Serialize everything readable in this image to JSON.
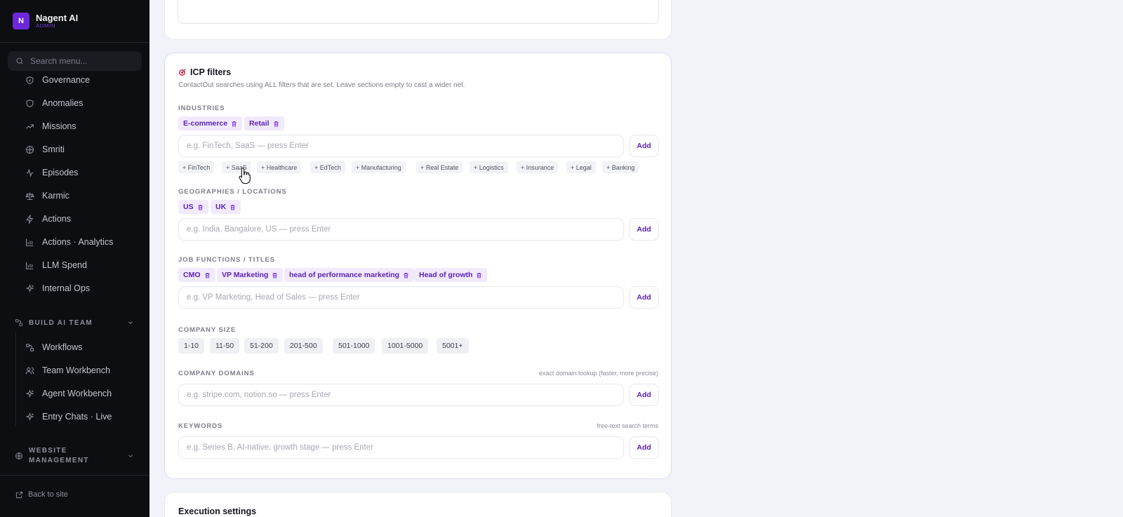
{
  "app": {
    "logo_letter": "N",
    "name": "Nagent AI",
    "role": "ADMIN"
  },
  "sidebar": {
    "search_placeholder": "Search menu...",
    "items": [
      {
        "label": "Governance",
        "icon": "shield-icon"
      },
      {
        "label": "Anomalies",
        "icon": "shield-icon"
      },
      {
        "label": "Missions",
        "icon": "trending-up-icon"
      },
      {
        "label": "Smriti",
        "icon": "brain-icon"
      },
      {
        "label": "Episodes",
        "icon": "activity-icon"
      },
      {
        "label": "Karmic",
        "icon": "scale-icon"
      },
      {
        "label": "Actions",
        "icon": "lightning-icon"
      },
      {
        "label": "Actions · Analytics",
        "icon": "bar-chart-icon"
      },
      {
        "label": "LLM Spend",
        "icon": "bar-chart-icon"
      },
      {
        "label": "Internal Ops",
        "icon": "sparkles-icon"
      }
    ],
    "section_build": {
      "label": "BUILD AI TEAM",
      "items": [
        {
          "label": "Workflows",
          "icon": "workflow-icon"
        },
        {
          "label": "Team Workbench",
          "icon": "users-icon"
        },
        {
          "label": "Agent Workbench",
          "icon": "sparkles-icon"
        },
        {
          "label": "Entry Chats · Live",
          "icon": "sparkles-icon"
        }
      ]
    },
    "section_website": {
      "label_line1": "WEBSITE",
      "label_line2": "MANAGEMENT"
    },
    "back_link": "Back to site"
  },
  "icp": {
    "title": "ICP filters",
    "subtitle": "ContactOut searches using ALL filters that are set. Leave sections empty to cast a wider net.",
    "industries": {
      "label": "INDUSTRIES",
      "chips": [
        "E-commerce",
        "Retail"
      ],
      "placeholder": "e.g. FinTech, SaaS — press Enter",
      "suggestions": [
        "+ FinTech",
        "+ SaaS",
        "+ Healthcare",
        "+ EdTech",
        "+ Manufacturing",
        "+ Real Estate",
        "+ Logistics",
        "+ Insurance",
        "+ Legal",
        "+ Banking"
      ]
    },
    "geographies": {
      "label": "GEOGRAPHIES / LOCATIONS",
      "chips": [
        "US",
        "UK"
      ],
      "placeholder": "e.g. India, Bangalore, US — press Enter"
    },
    "job_functions": {
      "label": "JOB FUNCTIONS / TITLES",
      "chips": [
        "CMO",
        "VP Marketing",
        "head of performance marketing",
        "Head of growth"
      ],
      "placeholder": "e.g. VP Marketing, Head of Sales — press Enter"
    },
    "company_size": {
      "label": "COMPANY SIZE",
      "options": [
        "1-10",
        "11-50",
        "51-200",
        "201-500",
        "501-1000",
        "1001-5000",
        "5001+"
      ]
    },
    "company_domains": {
      "label": "COMPANY DOMAINS",
      "hint": "exact domain lookup (faster, more precise)",
      "placeholder": "e.g. stripe.com, notion.so — press Enter"
    },
    "keywords": {
      "label": "KEYWORDS",
      "hint": "free-text search terms",
      "placeholder": "e.g. Series B, AI-native, growth stage — press Enter"
    },
    "add_label": "Add"
  },
  "execution": {
    "title": "Execution settings"
  }
}
